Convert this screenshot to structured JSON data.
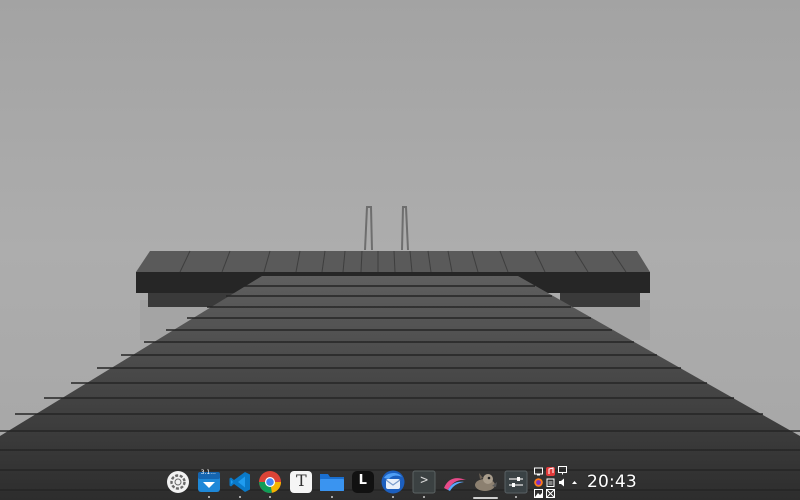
{
  "desktop": {
    "wallpaper": "foggy-lake-wooden-pier",
    "colors": {
      "sky": "#a9a9a9",
      "deck_dark": "#2e2e2e"
    }
  },
  "taskbar": {
    "launchers": [
      {
        "name": "system-menu",
        "icon": "gear-icon"
      },
      {
        "name": "updater",
        "icon": "package-update-icon",
        "badge": "3.1..."
      },
      {
        "name": "vscode",
        "icon": "vscode-icon"
      },
      {
        "name": "chrome",
        "icon": "chrome-icon"
      },
      {
        "name": "typora",
        "icon": "typora-icon",
        "glyph": "T"
      },
      {
        "name": "files",
        "icon": "folder-icon"
      },
      {
        "name": "launcher-app",
        "icon": "app-l-icon",
        "glyph": "L"
      },
      {
        "name": "thunderbird",
        "icon": "thunderbird-icon"
      },
      {
        "name": "terminal",
        "icon": "terminal-icon",
        "glyph": ">"
      },
      {
        "name": "paint-app",
        "icon": "paint-brush-icon"
      },
      {
        "name": "gimp",
        "icon": "gimp-icon"
      },
      {
        "name": "settings",
        "icon": "sliders-icon"
      }
    ],
    "tray_icons": [
      "screen-icon",
      "music-icon",
      "monitor-icon",
      "firefox-icon",
      "clipboard-icon",
      "volume-icon",
      "chevron-up-icon",
      "image-icon",
      "scanner-icon"
    ],
    "clock": "20:43"
  }
}
